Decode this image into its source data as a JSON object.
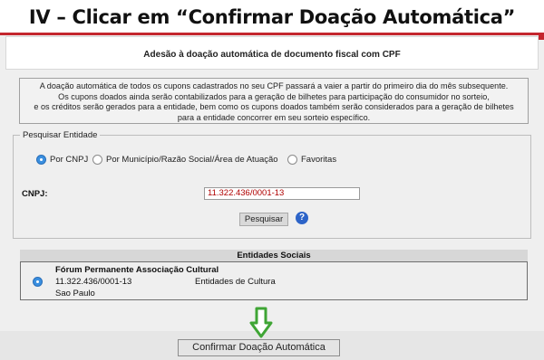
{
  "slide": {
    "title": "IV – Clicar em “Confirmar Doação Automática”"
  },
  "header": {
    "title": "Adesão à doação automática de documento fiscal com CPF"
  },
  "info": {
    "lines": [
      "A doação automática de todos os cupons cadastrados no seu CPF passará a vaier a partir do primeiro dia do mês subsequente.",
      "Os cupons doados ainda serão contabilizados para a geração de bilhetes para participação do consumidor no sorteio,",
      "e os créditos serão gerados para a entidade, bem como os cupons doados também serão considerados para a geração de bilhetes",
      "para a entidade concorrer em seu sorteio específico."
    ]
  },
  "search": {
    "legend": "Pesquisar Entidade",
    "options": [
      {
        "label": "Por CNPJ",
        "selected": true
      },
      {
        "label": "Por Município/Razão Social/Área de Atuação",
        "selected": false
      },
      {
        "label": "Favoritas",
        "selected": false
      }
    ],
    "cnpj_label": "CNPJ:",
    "cnpj_value": "11.322.436/0001-13",
    "search_button": "Pesquisar",
    "help_icon": "question-icon"
  },
  "table": {
    "header": "Entidades Sociais",
    "rows": [
      {
        "selected": true,
        "name": "Fórum Permanente Associação Cultural",
        "cnpj": "11.322.436/0001-13",
        "area": "Entidades de Cultura",
        "city": "Sao Paulo"
      }
    ]
  },
  "confirm_button": "Confirmar Doação Automática",
  "colors": {
    "accent": "#c4262e",
    "arrow": "#3fa535",
    "radio": "#3a8fe0",
    "cnpj_text": "#b00000"
  }
}
